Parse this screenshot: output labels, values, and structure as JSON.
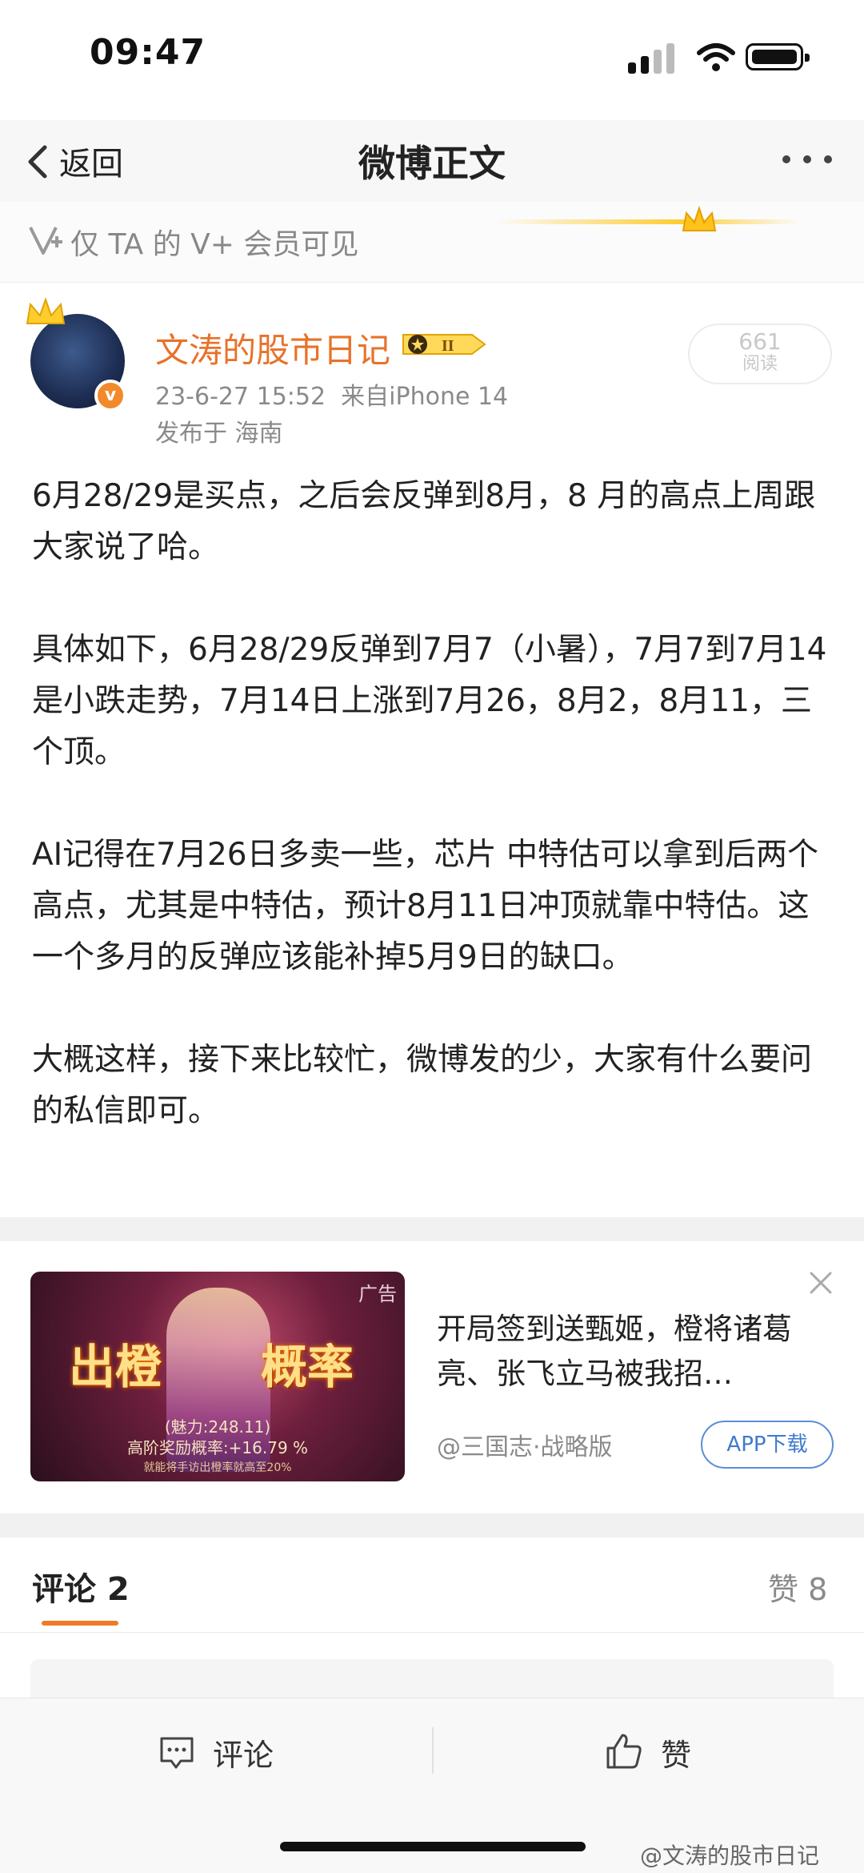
{
  "status_bar": {
    "time": "09:47"
  },
  "nav": {
    "back_label": "返回",
    "title": "微博正文"
  },
  "visibility": {
    "text": "仅 TA 的 V+ 会员可见"
  },
  "post": {
    "author": "文涛的股市日记",
    "verified_mark": "v",
    "badge_text": "II",
    "time": "23-6-27 15:52",
    "source": "来自iPhone 14",
    "location": "发布于 海南",
    "reads_count": "661",
    "reads_label": "阅读",
    "paragraphs": [
      "6月28/29是买点，之后会反弹到8月，8 月的高点上周跟大家说了哈。",
      "具体如下，6月28/29反弹到7月7（小暑），7月7到7月14是小跌走势，7月14日上涨到7月26，8月2，8月11，三个顶。",
      "AI记得在7月26日多卖一些，芯片 中特估可以拿到后两个高点，尤其是中特估，预计8月11日冲顶就靠中特估。这一个多月的反弹应该能补掉5月9日的缺口。",
      "大概这样，接下来比较忙，微博发的少，大家有什么要问的私信即可。"
    ]
  },
  "ad": {
    "tag": "广告",
    "image_word_1": "出橙",
    "image_word_2": "概率",
    "image_line_1": "(魅力:248.11)",
    "image_line_2": "高阶奖励概率:+16.79 %",
    "image_line_3": "就能将手访出橙率就高至20%",
    "title": "开局签到送甄姬，橙将诸葛亮、张飞立马被我招…",
    "source": "@三国志·战略版",
    "button": "APP下载"
  },
  "comments_tab": {
    "label": "评论 2",
    "likes_label": "赞 8"
  },
  "toolbar": {
    "comment_label": "评论",
    "like_label": "赞"
  },
  "watermark": "@文涛的股市日记"
}
